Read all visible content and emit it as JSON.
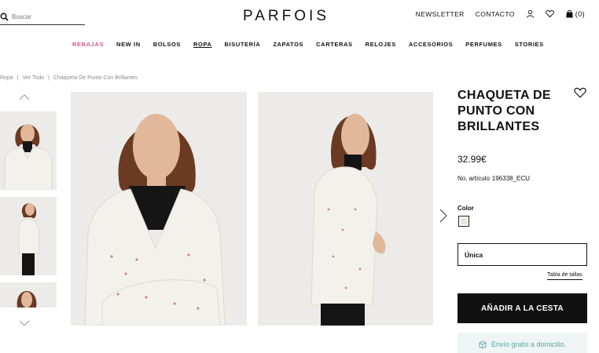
{
  "header": {
    "search_placeholder": "Buscar",
    "logo": "PARFOIS",
    "newsletter": "NEWSLETTER",
    "contact": "CONTACTO",
    "cart_count": "(0)"
  },
  "nav": {
    "items": [
      "REBAJAS",
      "NEW IN",
      "BOLSOS",
      "ROPA",
      "BISUTERÍA",
      "ZAPATOS",
      "CARTERAS",
      "RELOJES",
      "ACCESORIOS",
      "PERFUMES",
      "STORIES"
    ],
    "sale_color": "#d4578b"
  },
  "breadcrumb": {
    "items": [
      "Ropa",
      "Ver Todo",
      "Chaqueta De Punto Con Brillantes"
    ],
    "separator": "|"
  },
  "product": {
    "title": "CHAQUETA DE PUNTO CON BRILLANTES",
    "price": "32.99€",
    "sku_label": "No. artículo",
    "sku": "196338_ECU",
    "color_label": "Color",
    "swatch_color": "#ece6dd",
    "size": "Única",
    "size_guide": "Tabla de tallas",
    "add_to_cart": "AÑADIR A LA CESTA",
    "shipping": "Envío gratis a domicilio.",
    "shipping_color": "#5aa699"
  }
}
